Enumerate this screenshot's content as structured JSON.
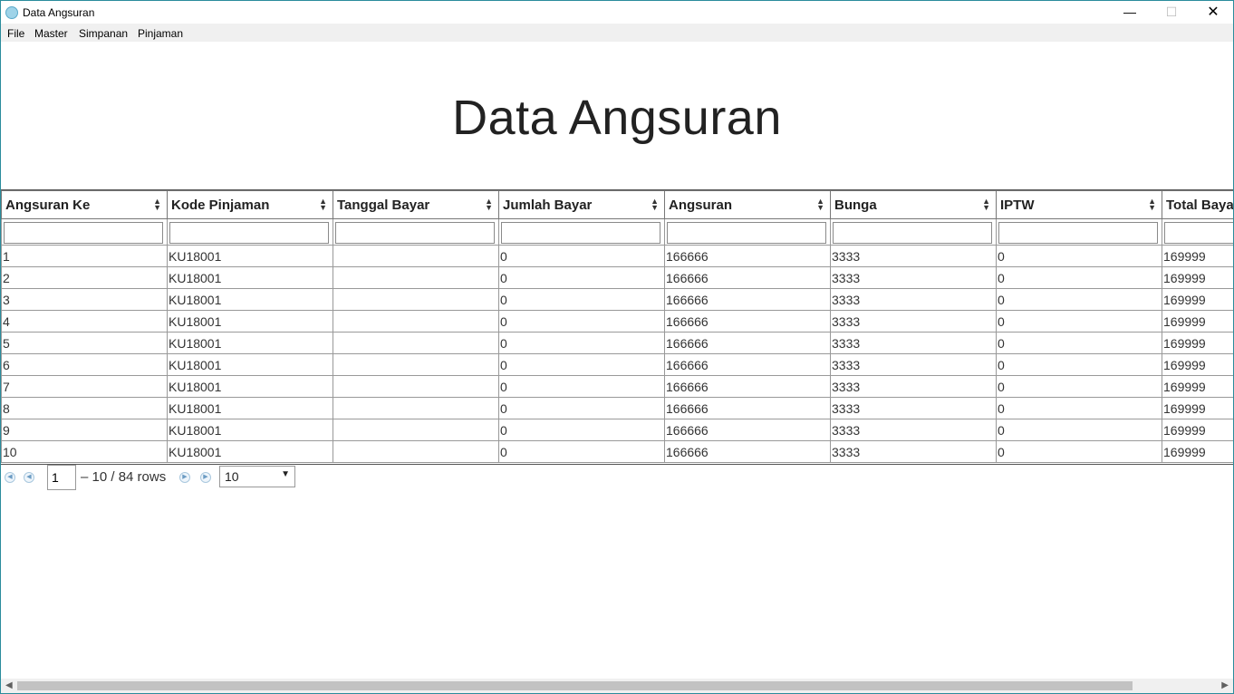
{
  "window": {
    "title": "Data Angsuran"
  },
  "menu": [
    "File",
    "Master",
    "Simpanan",
    "Pinjaman"
  ],
  "page_title": "Data Angsuran",
  "table": {
    "columns": [
      "Angsuran Ke",
      "Kode Pinjaman",
      "Tanggal Bayar",
      "Jumlah Bayar",
      "Angsuran",
      "Bunga",
      "IPTW",
      "Total Bayar"
    ],
    "rows": [
      [
        "1",
        "KU18001",
        "",
        "0",
        "166666",
        "3333",
        "0",
        "169999"
      ],
      [
        "2",
        "KU18001",
        "",
        "0",
        "166666",
        "3333",
        "0",
        "169999"
      ],
      [
        "3",
        "KU18001",
        "",
        "0",
        "166666",
        "3333",
        "0",
        "169999"
      ],
      [
        "4",
        "KU18001",
        "",
        "0",
        "166666",
        "3333",
        "0",
        "169999"
      ],
      [
        "5",
        "KU18001",
        "",
        "0",
        "166666",
        "3333",
        "0",
        "169999"
      ],
      [
        "6",
        "KU18001",
        "",
        "0",
        "166666",
        "3333",
        "0",
        "169999"
      ],
      [
        "7",
        "KU18001",
        "",
        "0",
        "166666",
        "3333",
        "0",
        "169999"
      ],
      [
        "8",
        "KU18001",
        "",
        "0",
        "166666",
        "3333",
        "0",
        "169999"
      ],
      [
        "9",
        "KU18001",
        "",
        "0",
        "166666",
        "3333",
        "0",
        "169999"
      ],
      [
        "10",
        "KU18001",
        "",
        "0",
        "166666",
        "3333",
        "0",
        "169999"
      ]
    ]
  },
  "pager": {
    "page": "1",
    "rows_text": "– 10 / 84 rows",
    "page_size": "10"
  },
  "colors": {
    "accent_border": "#2a8c9c",
    "menubar": "#f0f0f0"
  }
}
